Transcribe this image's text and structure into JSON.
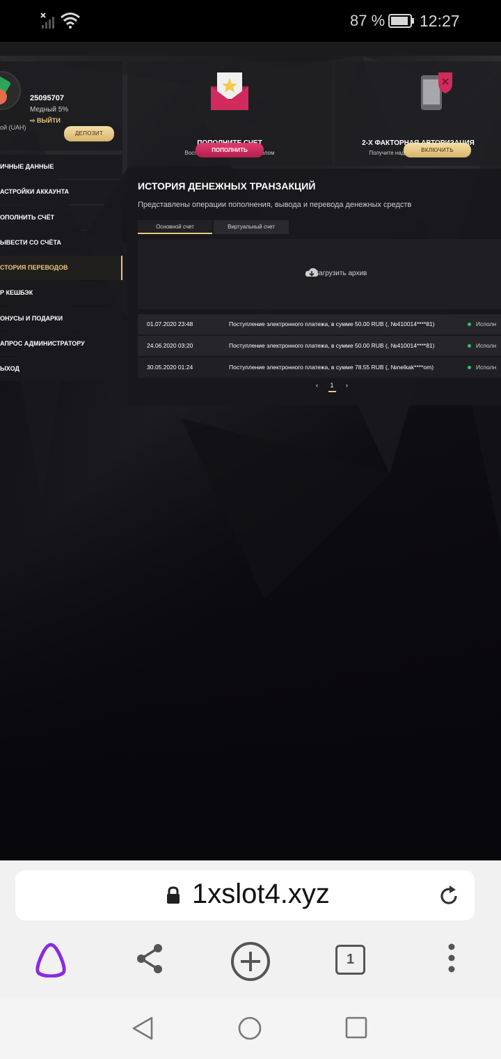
{
  "status_bar": {
    "battery_percent": "87 %",
    "time": "12:27",
    "icons": [
      "signal-off-icon",
      "wifi-icon",
      "battery-icon"
    ]
  },
  "profile": {
    "user_id": "25095707",
    "level": "Медный 5%",
    "logout_label": "ВЫЙТИ",
    "currency": "ой (UAH)",
    "deposit_label": "ДЕПОЗИТ"
  },
  "menu": {
    "items": [
      "ИЧНЫЕ ДАННЫЕ",
      "АСТРОЙКИ АККАУНТА",
      "ОПОЛНИТЬ СЧЁТ",
      "ЫВЕСТИ СО СЧЁТА",
      "СТОРИЯ ПЕРЕВОДОВ",
      "Р КЕШБЭК",
      "ОНУСЫ И ПОДАРКИ",
      "АПРОС АДМИНИСТРАТОРУ",
      "ЫХОД"
    ],
    "active_index": 4
  },
  "cards": [
    {
      "title": "ПОПОЛНИТЕ СЧЕТ",
      "subtitle": "Воспользуйтесь данным разделом",
      "button": "ПОПОЛНИТЬ",
      "icon": "envelope-star-icon"
    },
    {
      "title": "2-Х ФАКТОРНАЯ АВТОРИЗАЦИЯ",
      "subtitle": "Получите надёжную защиту аккаунта!",
      "button": "ВКЛЮЧИТЬ",
      "icon": "phone-shield-icon"
    }
  ],
  "transactions": {
    "title": "ИСТОРИЯ ДЕНЕЖНЫХ ТРАНЗАКЦИЙ",
    "description": "Представлены операции пополнения, вывода и перевода денежных средств",
    "tabs": [
      "Основной счет",
      "Виртуальный счет"
    ],
    "archive_label": "Загрузить архив",
    "rows": [
      {
        "date": "01.07.2020 23:48",
        "text": "Поступление электронного платежа, в сумме 50.00 RUB (, №410014****81)",
        "status": "Исполн"
      },
      {
        "date": "24.06.2020 03:20",
        "text": "Поступление электронного платежа, в сумме 50.00 RUB (, №410014****81)",
        "status": "Исполн"
      },
      {
        "date": "30.05.2020 01:24",
        "text": "Поступление электронного платежа, в сумме 78.55 RUB (, №nelkak****om)",
        "status": "Исполн"
      }
    ],
    "pager": {
      "prev": "‹",
      "page": "1",
      "next": "›"
    }
  },
  "browser": {
    "url": "1xslot4.xyz",
    "tab_count": "1",
    "toolbar_icons": [
      "alice-icon",
      "share-icon",
      "new-tab-icon",
      "tabs-icon",
      "more-icon"
    ]
  },
  "colors": {
    "accent_gold": "#e8c77d",
    "accent_pink": "#d12b5e",
    "status_green": "#2ec26a"
  }
}
